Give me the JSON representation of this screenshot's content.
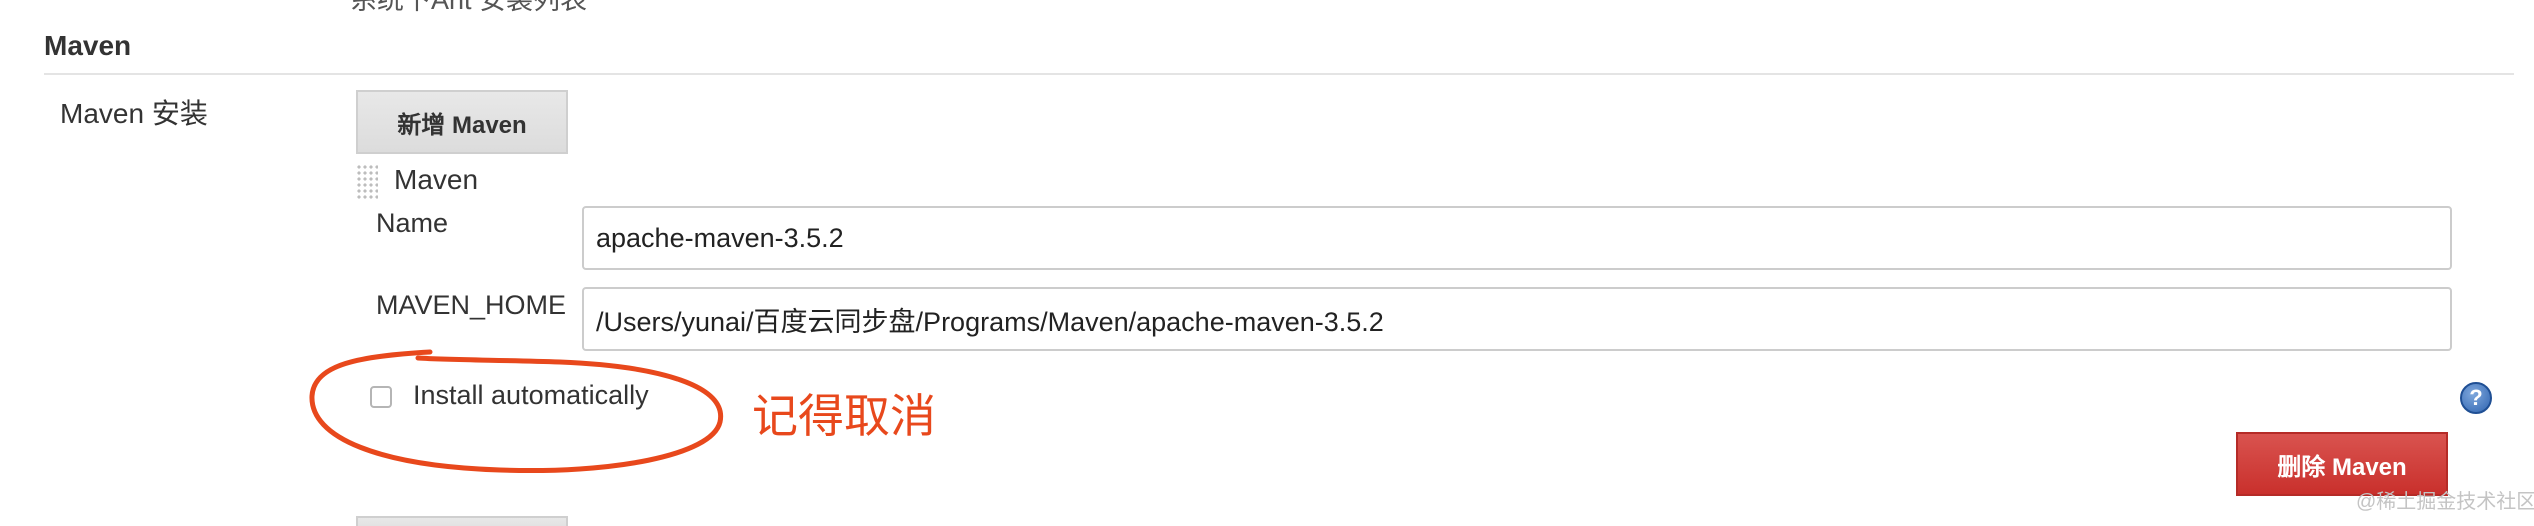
{
  "cut_off_text": "系统下Ant 安装列表",
  "section": {
    "title": "Maven"
  },
  "row": {
    "label": "Maven 安装"
  },
  "add_button": {
    "label": "新增 Maven"
  },
  "installation": {
    "title": "Maven",
    "fields": {
      "name": {
        "label": "Name",
        "value": "apache-maven-3.5.2"
      },
      "home": {
        "label": "MAVEN_HOME",
        "value": "/Users/yunai/百度云同步盘/Programs/Maven/apache-maven-3.5.2"
      }
    },
    "install_automatically": {
      "label": "Install automatically",
      "checked": false
    },
    "help_icon": "question-help-icon",
    "delete_button": {
      "label": "删除 Maven"
    }
  },
  "annotation": {
    "text": "记得取消",
    "color": "#e8481c"
  },
  "watermark": "@稀土掘金技术社区",
  "colors": {
    "delete_button": "#d9534f",
    "help_icon": "#2f64b0"
  }
}
